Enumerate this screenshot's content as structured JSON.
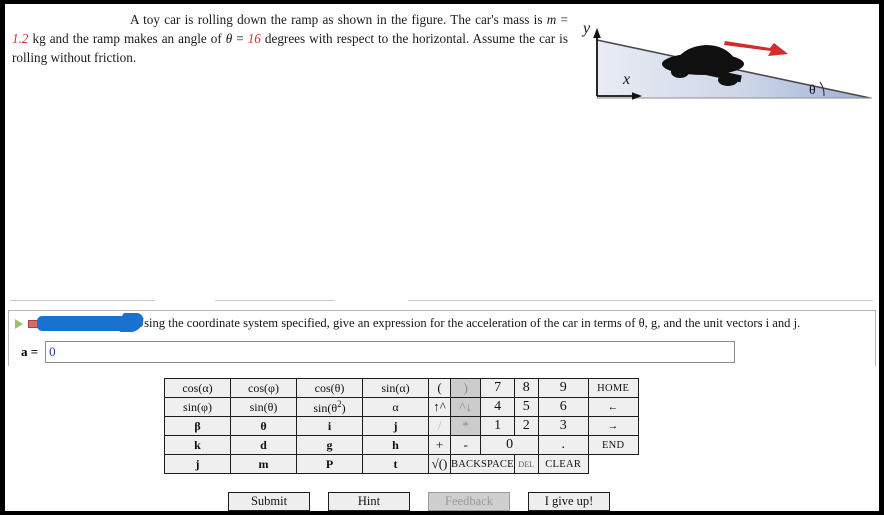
{
  "problem": {
    "intro": "A toy car is rolling down the ramp as shown in the figure. The car's mass is ",
    "m_symbol": "m",
    "eq1": " = ",
    "mass_value": "1.2",
    "mass_unit": " kg and the ramp makes an angle of ",
    "theta_symbol": "θ",
    "eq2": " = ",
    "angle_value": "16",
    "tail": " degrees with respect to the horizontal. Assume the car is rolling without friction."
  },
  "figure": {
    "y_label": "y",
    "x_label": "x",
    "theta_label": "θ",
    "ramp_fill_start": "#e8ecf5",
    "ramp_fill_end": "#9fb0d4",
    "arrow_color": "#d42c2c",
    "car_color": "#101010"
  },
  "question": {
    "text": "Using the coordinate system specified, give an expression for the acceleration of the car in terms of θ, g, and the unit vectors i and j.",
    "expand_icon": "play-triangle-icon",
    "flag_icon": "flag-icon",
    "redaction": "blue-redaction-mark"
  },
  "answer": {
    "label": "a =",
    "value": "0",
    "placeholder": ""
  },
  "keypad": {
    "rows": [
      [
        {
          "label": "cos(α)",
          "kind": "fn"
        },
        {
          "label": "cos(φ)",
          "kind": "fn"
        },
        {
          "label": "cos(θ)",
          "kind": "fn"
        },
        {
          "label": "sin(α)",
          "kind": "fn"
        },
        {
          "label": "(",
          "kind": "op"
        },
        {
          "label": ")",
          "kind": "op-disabled"
        },
        {
          "label": "7",
          "kind": "num"
        },
        {
          "label": "8",
          "kind": "num"
        },
        {
          "label": "9",
          "kind": "num"
        },
        {
          "label": "HOME",
          "kind": "act"
        }
      ],
      [
        {
          "label": "sin(φ)",
          "kind": "fn"
        },
        {
          "label": "sin(θ)",
          "kind": "fn"
        },
        {
          "label": "sin(θ²)",
          "kind": "fn-sup"
        },
        {
          "label": "α",
          "kind": "fn"
        },
        {
          "label": "↑^",
          "kind": "op"
        },
        {
          "label": "^↓",
          "kind": "op-disabled"
        },
        {
          "label": "4",
          "kind": "num"
        },
        {
          "label": "5",
          "kind": "num"
        },
        {
          "label": "6",
          "kind": "num"
        },
        {
          "label": "←",
          "kind": "act"
        }
      ],
      [
        {
          "label": "β",
          "kind": "fn-bold"
        },
        {
          "label": "θ",
          "kind": "fn-bold"
        },
        {
          "label": "i",
          "kind": "fn-bold"
        },
        {
          "label": "j",
          "kind": "fn-bold"
        },
        {
          "label": "/",
          "kind": "op-faded"
        },
        {
          "label": "*",
          "kind": "op-disabled"
        },
        {
          "label": "1",
          "kind": "num"
        },
        {
          "label": "2",
          "kind": "num"
        },
        {
          "label": "3",
          "kind": "num"
        },
        {
          "label": "→",
          "kind": "act"
        }
      ],
      [
        {
          "label": "k",
          "kind": "fn-bold"
        },
        {
          "label": "d",
          "kind": "fn-bold"
        },
        {
          "label": "g",
          "kind": "fn-bold"
        },
        {
          "label": "h",
          "kind": "fn-bold"
        },
        {
          "label": "+",
          "kind": "op"
        },
        {
          "label": "-",
          "kind": "op"
        },
        {
          "label": "0",
          "kind": "num-wide"
        },
        {
          "label": ".",
          "kind": "num"
        },
        {
          "label": "END",
          "kind": "act"
        }
      ],
      [
        {
          "label": "j",
          "kind": "fn-bold"
        },
        {
          "label": "m",
          "kind": "fn-bold"
        },
        {
          "label": "P",
          "kind": "fn-bold"
        },
        {
          "label": "t",
          "kind": "fn-bold"
        },
        {
          "label": "√()",
          "kind": "op"
        },
        {
          "label": "BACKSPACE",
          "kind": "backspace"
        },
        {
          "label": "DEL",
          "kind": "del"
        },
        {
          "label": "CLEAR",
          "kind": "act"
        }
      ]
    ]
  },
  "footer": {
    "submit": "Submit",
    "hint": "Hint",
    "feedback": "Feedback",
    "give_up": "I give up!"
  }
}
